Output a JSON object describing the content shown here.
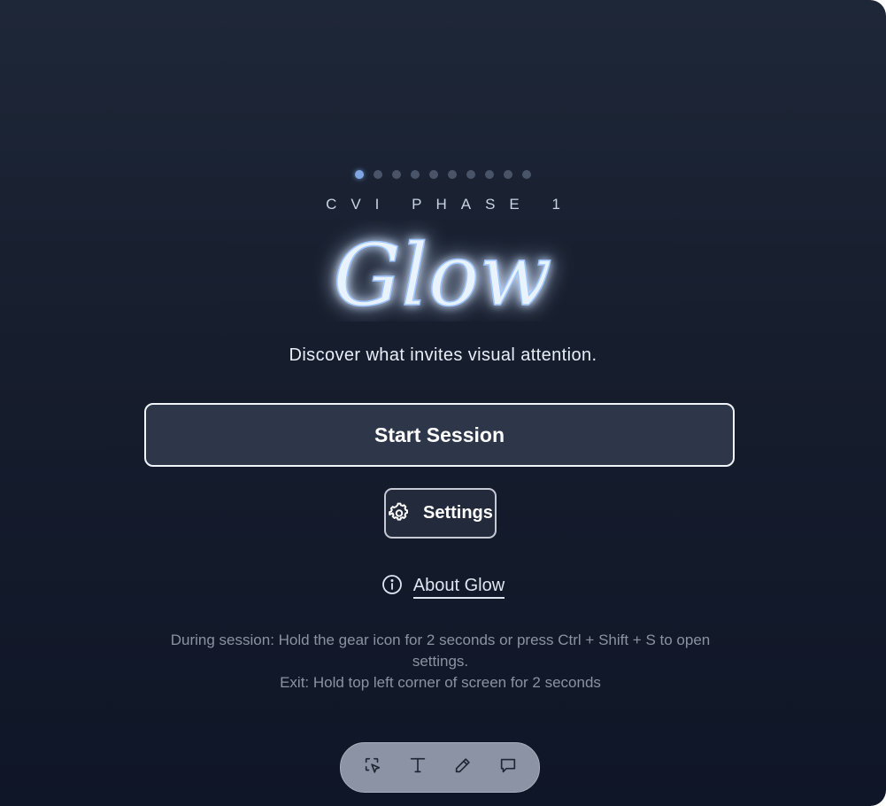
{
  "progress": {
    "total_steps": 10,
    "current_step": 1,
    "active_color": "#7fa6e2",
    "inactive_color": "#4a5468"
  },
  "header": {
    "eyebrow": "CVI PHASE 1",
    "logo_text": "Glow",
    "logo_glow_color": "#9fc6ff"
  },
  "tagline": "Discover what invites visual attention.",
  "actions": {
    "start_label": "Start Session",
    "settings_label": "Settings",
    "settings_icon": "gear-icon",
    "about_label": "About Glow",
    "about_icon": "info-icon"
  },
  "help": {
    "line1": "During session: Hold the gear icon for 2 seconds or press Ctrl + Shift + S to open settings.",
    "line2": "Exit: Hold top left corner of screen for 2 seconds"
  },
  "toolbar": {
    "items": [
      {
        "icon": "select-region-icon"
      },
      {
        "icon": "text-icon"
      },
      {
        "icon": "pencil-icon"
      },
      {
        "icon": "comment-icon"
      }
    ]
  },
  "colors": {
    "background_top": "#1e2738",
    "background_bottom": "#0f1627",
    "button_bg": "#2e3749",
    "text_muted": "#8b93a3"
  }
}
